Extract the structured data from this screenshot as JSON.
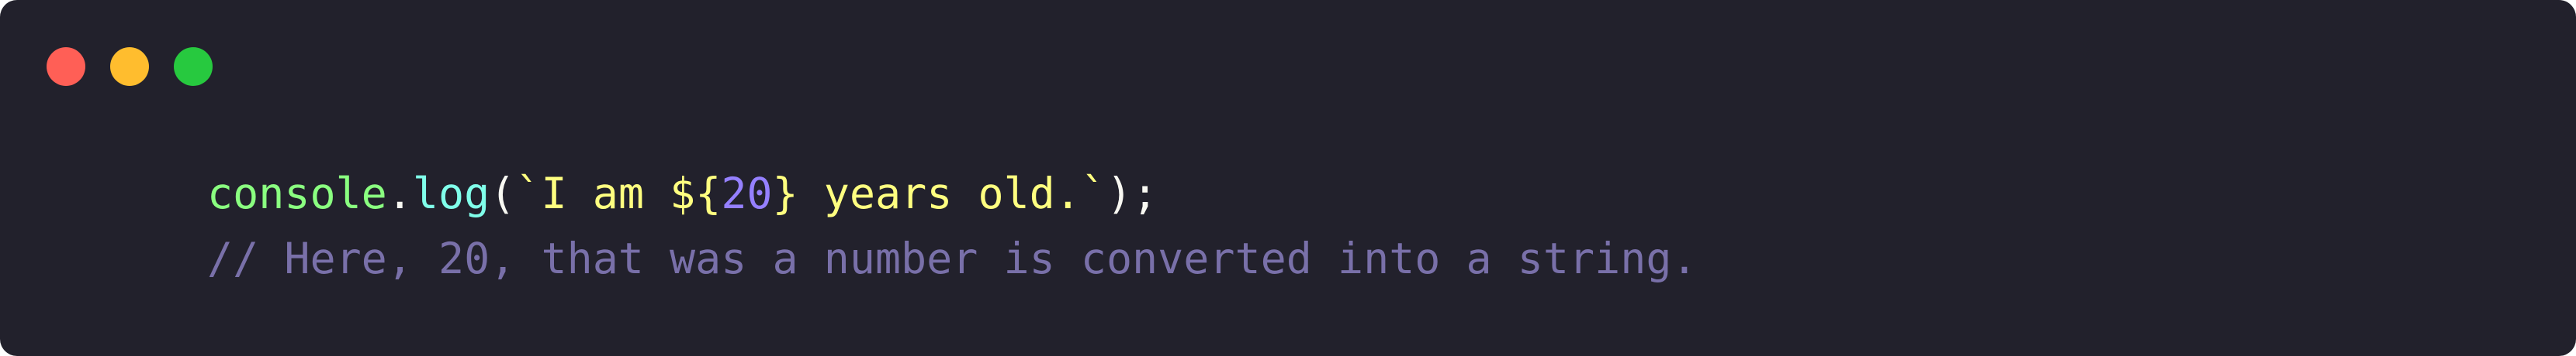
{
  "window": {
    "controls": [
      "close",
      "minimize",
      "maximize"
    ],
    "colors": {
      "background": "#22212c",
      "close": "#ff5f56",
      "minimize": "#ffbd2e",
      "maximize": "#27c93f"
    }
  },
  "code": {
    "line1": {
      "object": "console",
      "dot": ".",
      "method": "log",
      "open_paren": "(",
      "template_start": "`I am ",
      "interp_open": "${",
      "number": "20",
      "interp_close": "}",
      "template_end": " years old.`",
      "close_paren": ")",
      "semicolon": ";"
    },
    "line2": {
      "comment": "// Here, 20, that was a number is converted into a string."
    }
  },
  "syntax_colors": {
    "identifier": "#8aff80",
    "function": "#80ffea",
    "string": "#ffff80",
    "number": "#9580ff",
    "comment": "#7970a9",
    "punctuation": "#f8f8f2"
  }
}
